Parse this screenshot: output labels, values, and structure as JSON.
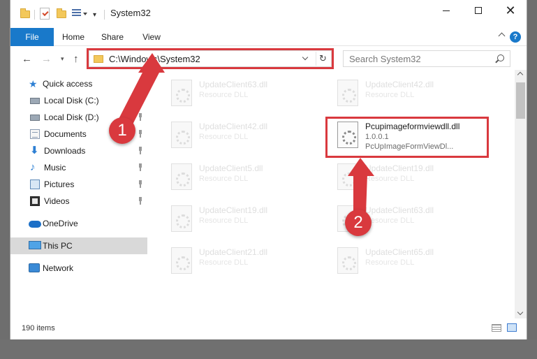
{
  "window": {
    "title": "System32",
    "controls": {
      "minimize": "–",
      "maximize": "☐",
      "close": "✕"
    }
  },
  "ribbon": {
    "tabs": [
      "File",
      "Home",
      "Share",
      "View"
    ],
    "help": "?"
  },
  "address": {
    "path": "C:\\Windows\\System32",
    "refresh_icon": "↻"
  },
  "search": {
    "placeholder": "Search System32"
  },
  "nav": {
    "back": "←",
    "forward": "→",
    "up": "↑",
    "recent": "▾",
    "items": [
      {
        "label": "Quick access",
        "icon": "star-icon"
      },
      {
        "label": "Local Disk (C:)",
        "icon": "disk-icon",
        "pinned": true
      },
      {
        "label": "Local Disk (D:)",
        "icon": "disk-icon",
        "pinned": true
      },
      {
        "label": "Documents",
        "icon": "documents-icon",
        "pinned": true
      },
      {
        "label": "Downloads",
        "icon": "download-icon",
        "pinned": true
      },
      {
        "label": "Music",
        "icon": "music-icon",
        "pinned": true
      },
      {
        "label": "Pictures",
        "icon": "pictures-icon",
        "pinned": true
      },
      {
        "label": "Videos",
        "icon": "videos-icon",
        "pinned": true
      },
      {
        "label": "OneDrive",
        "icon": "cloud-icon"
      },
      {
        "label": "This PC",
        "icon": "computer-icon",
        "selected": true
      },
      {
        "label": "Network",
        "icon": "network-icon"
      }
    ]
  },
  "files": {
    "left": [
      {
        "name": "UpdateClient63.dll",
        "type": "Resource DLL"
      },
      {
        "name": "UpdateClient42.dll",
        "type": "Resource DLL"
      },
      {
        "name": "UpdateClient5.dll",
        "type": "Resource DLL"
      },
      {
        "name": "UpdateClient19.dll",
        "type": "Resource DLL"
      },
      {
        "name": "UpdateClient21.dll",
        "type": "Resource DLL"
      }
    ],
    "right": [
      {
        "name": "UpdateClient42.dll",
        "type": "Resource DLL"
      },
      {
        "name": "Pcupimageformviewdll.dll",
        "version": "1.0.0.1",
        "description": "PcUpImageFormViewDl...",
        "highlighted": true
      },
      {
        "name": "UpdateClient19.dll",
        "type": "Resource DLL"
      },
      {
        "name": "UpdateClient63.dll",
        "type": "Resource DLL"
      },
      {
        "name": "UpdateClient65.dll",
        "type": "Resource DLL"
      }
    ]
  },
  "status": {
    "item_count": "190 items"
  },
  "annotations": {
    "step1": "1",
    "step2": "2",
    "color": "#d9393e"
  }
}
